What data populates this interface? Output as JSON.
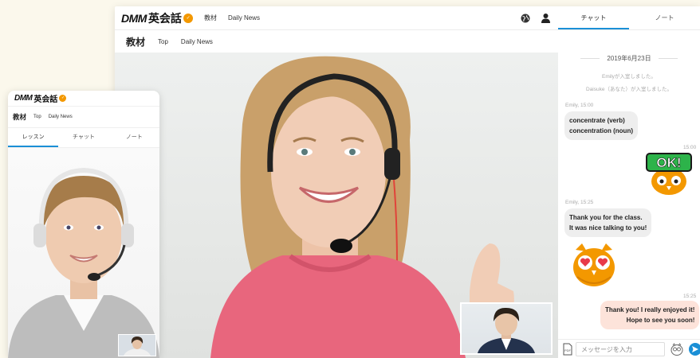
{
  "brand": {
    "name_latin": "DMM",
    "name_jp": "英会話",
    "badge": "eikaiwa",
    "accent": "#f39800"
  },
  "desktop": {
    "topnav": [
      "教材",
      "Daily News"
    ],
    "subbar": {
      "title": "教材",
      "links": [
        "Top",
        "Daily News"
      ]
    },
    "icons": {
      "globe": "globe-icon",
      "user": "user-icon"
    }
  },
  "chat": {
    "tabs": [
      "チャット",
      "ノート"
    ],
    "date": "2019年6月23日",
    "system_messages": [
      "Emilyが入室しました。",
      "Daisuke（あなた）が入室しました。"
    ],
    "messages": [
      {
        "sender": "Emily",
        "time": "15:00",
        "lines": [
          "concentrate (verb)",
          "concentration (noun)"
        ]
      },
      {
        "sender": "me",
        "time": "15:00",
        "stamp": "OK!"
      },
      {
        "sender": "Emily",
        "time": "15:25",
        "lines": [
          "Thank you for the class.",
          "It was nice talking to you!"
        ]
      },
      {
        "sender": "Emily",
        "stamp": "heart-eyes"
      },
      {
        "sender": "me",
        "time": "15:25",
        "lines": [
          "Thank you! I really enjoyed it!",
          "Hope to see you soon!"
        ]
      }
    ],
    "input": {
      "placeholder": "メッセージを入力"
    },
    "icons": {
      "pdf": "pdf-icon",
      "stamp": "owl-stamp-icon",
      "send": "send-icon"
    }
  },
  "mobile": {
    "subbar": {
      "title": "教材",
      "links": [
        "Top",
        "Daily News"
      ]
    },
    "tabs": [
      "レッスン",
      "チャット",
      "ノート"
    ]
  },
  "colors": {
    "tab_active": "#1a8fd6",
    "own_bubble": "#fde3da",
    "other_bubble": "#eeeeee",
    "stamp_orange": "#f39800",
    "stamp_green": "#2db34a"
  }
}
